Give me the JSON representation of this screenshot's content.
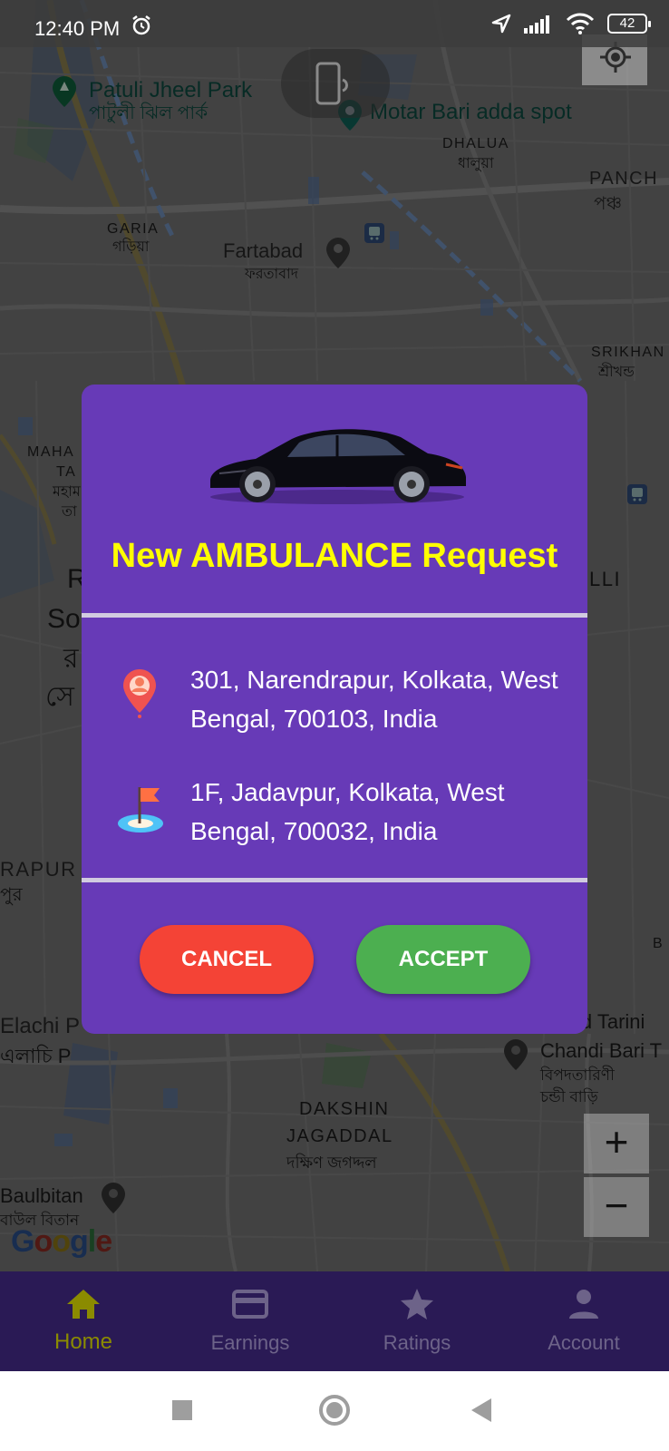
{
  "status_bar": {
    "time": "12:40 PM",
    "battery": "42"
  },
  "map": {
    "places": {
      "patuli_en": "Patuli Jheel Park",
      "patuli_bn": "পাটুলী ঝিল পার্ক",
      "motar": "Motar Bari adda spot",
      "dhalua_en": "DHALUA",
      "dhalua_bn": "ধালুয়া",
      "panch_en": "PANCH",
      "panch_bn": "পঞ্চ",
      "garia_en": "GARIA",
      "garia_bn": "গড়িয়া",
      "fartabad_en": "Fartabad",
      "fartabad_bn": "ফরতাবাদ",
      "srikhan_en": "SRIKHAN",
      "srikhan_bn": "শ্রীখন্ড",
      "maha_en": "MAHA",
      "maha_en2": "TA",
      "maha_bn": "মহাম",
      "maha_bn2": "তা",
      "r1": "R",
      "so": "So",
      "ra_bn": "র",
      "se_bn": "সে",
      "lli": "LLI",
      "rapur_en": "RAPUR",
      "rapur_bn": "পুর",
      "b": "B",
      "elachi_en": "Elachi P",
      "elachi_bn": "এলাচি P",
      "tarini_en": "Pad Tarini",
      "chandi_en": "Chandi Bari T",
      "tarini_bn": "বিপদতারিণী",
      "chandi_bn": "চন্ডী বাড়ি",
      "dakshin_en": "DAKSHIN",
      "jagaddal_en": "JAGADDAL",
      "dakshin_bn": "দক্ষিণ জগদ্দল",
      "baulbitan_en": "Baulbitan",
      "baulbitan_bn": "বাউল বিতান",
      "google": "Google"
    },
    "zoom_in": "+",
    "zoom_out": "−"
  },
  "dialog": {
    "title": "New AMBULANCE Request",
    "pickup_address": "301, Narendrapur, Kolkata, West Bengal, 700103, India",
    "drop_address": "1F, Jadavpur, Kolkata, West Bengal, 700032, India",
    "cancel_label": "CANCEL",
    "accept_label": "ACCEPT"
  },
  "bottom_nav": {
    "items": [
      {
        "label": "Home",
        "icon": "home-icon",
        "active": true
      },
      {
        "label": "Earnings",
        "icon": "credit-card-icon",
        "active": false
      },
      {
        "label": "Ratings",
        "icon": "star-icon",
        "active": false
      },
      {
        "label": "Account",
        "icon": "person-icon",
        "active": false
      }
    ],
    "active_color": "#8b8b00",
    "inactive_color": "#6d6389"
  },
  "colors": {
    "dialog_bg": "#673ab7",
    "title": "#ffff00",
    "cancel": "#f44336",
    "accept": "#4caf50"
  }
}
